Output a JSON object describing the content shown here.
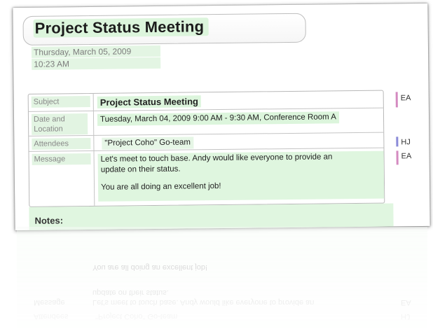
{
  "page": {
    "title": "Project Status Meeting",
    "date": "Thursday, March 05, 2009",
    "time": "10:23 AM"
  },
  "meeting": {
    "rows": [
      {
        "label": "Subject",
        "value": "Project Status Meeting"
      },
      {
        "label": "Date and Location",
        "value": "Tuesday, March 04, 2009 9:00 AM - 9:30 AM, Conference Room A"
      },
      {
        "label": "Attendees",
        "value": "\"Project Coho\" Go-team"
      },
      {
        "label": "Message",
        "value_line1": "Let's meet to touch base. Andy would like everyone to provide an",
        "value_line2": "update on their status.",
        "value_line3": "You are all doing an excellent job!"
      }
    ]
  },
  "notes": {
    "label": "Notes:"
  },
  "author_tags": [
    {
      "text": "EA",
      "color": "#d48ac0"
    },
    {
      "text": "HJ",
      "color": "#8a8ad8"
    },
    {
      "text": "EA",
      "color": "#d48ac0"
    }
  ],
  "colors": {
    "highlight": "#dcf5dc",
    "label_text": "#888888"
  }
}
